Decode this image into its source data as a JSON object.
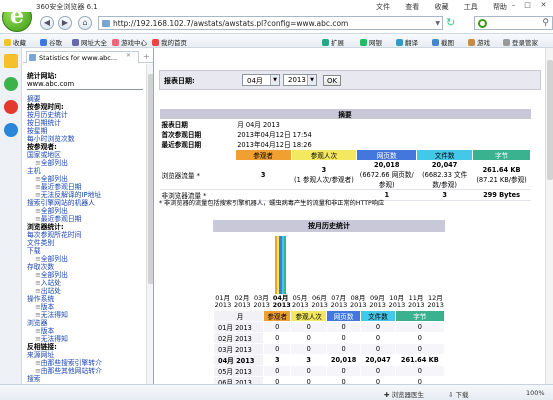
{
  "browser": {
    "title": "360安全浏览器 6.1",
    "menus": [
      "文件",
      "查看",
      "收藏",
      "工具",
      "帮助"
    ],
    "url": "http://192.168.102.7/awstats/awstats.pl?config=www.abc.com",
    "favorites": [
      "收藏",
      "谷歌",
      "网址大全",
      "游戏中心",
      "我的首页"
    ],
    "toolbar_right": [
      "扩展",
      "网银",
      "翻译",
      "截图",
      "游戏",
      "登录管家"
    ],
    "status": [
      "浏览器医生",
      "下载",
      "100%"
    ]
  },
  "sidebar": {
    "tab_title": "Statistics for www.abc...",
    "stats_label": "统计网站:",
    "site": "www.abc.com",
    "items": [
      {
        "t": "lk",
        "v": "摘要"
      },
      {
        "t": "sec",
        "v": "按参观时间:"
      },
      {
        "t": "lk",
        "v": "按月历史统计"
      },
      {
        "t": "lk",
        "v": "按日期统计"
      },
      {
        "t": "lk",
        "v": "按星期"
      },
      {
        "t": "lk",
        "v": "每小时浏览次数"
      },
      {
        "t": "sec",
        "v": "按参观者:"
      },
      {
        "t": "lk",
        "v": "国家或地区"
      },
      {
        "t": "sub",
        "v": "全部列出"
      },
      {
        "t": "lk",
        "v": "主机"
      },
      {
        "t": "sub",
        "v": "全部列出"
      },
      {
        "t": "sub",
        "v": "最近参观日期"
      },
      {
        "t": "sub",
        "v": "无法反解译的IP地址"
      },
      {
        "t": "lk",
        "v": "搜索引擎网站的机器人"
      },
      {
        "t": "sub",
        "v": "全部列出"
      },
      {
        "t": "sub",
        "v": "最近参观日期"
      },
      {
        "t": "sec",
        "v": "浏览器统计:"
      },
      {
        "t": "lk",
        "v": "每次参观所花时间"
      },
      {
        "t": "lk",
        "v": "文件类别"
      },
      {
        "t": "lk",
        "v": "下载"
      },
      {
        "t": "sub",
        "v": "全部列出"
      },
      {
        "t": "lk",
        "v": "存取次数"
      },
      {
        "t": "sub",
        "v": "全部列出"
      },
      {
        "t": "sub",
        "v": "入站处"
      },
      {
        "t": "sub",
        "v": "出站处"
      },
      {
        "t": "lk",
        "v": "操作系统"
      },
      {
        "t": "sub",
        "v": "版本"
      },
      {
        "t": "sub",
        "v": "无法得知"
      },
      {
        "t": "lk",
        "v": "浏览器"
      },
      {
        "t": "sub",
        "v": "版本"
      },
      {
        "t": "sub",
        "v": "无法得知"
      },
      {
        "t": "sec",
        "v": "反相链接:"
      },
      {
        "t": "lk",
        "v": "来源网址"
      },
      {
        "t": "sub",
        "v": "由那些搜索引擎转介"
      },
      {
        "t": "sub",
        "v": "由那些其他网站转介"
      },
      {
        "t": "lk",
        "v": "搜索"
      }
    ]
  },
  "main": {
    "date_label": "报表日期:",
    "month": "04月",
    "year": "2013",
    "ok": "OK",
    "summary": {
      "caption": "摘要",
      "report_date_k": "报表日期",
      "report_date_v": "月 04月 2013",
      "first_k": "首次参观日期",
      "first_v": "2013年04月12日 17:54",
      "last_k": "最近参观日期",
      "last_v": "2013年04月12日 18:26",
      "headers": [
        "参观者",
        "参观人次",
        "网页数",
        "文件数",
        "字节"
      ],
      "rows": [
        {
          "label": "浏览器流量 *",
          "visitors": "3",
          "visits": "3",
          "visits_note": "(1 参观人次/参观者)",
          "pages": "20,018",
          "pages_note": "(6672.66 网页数/参观)",
          "files": "20,047",
          "files_note": "(6682.33 文件数/参观)",
          "bytes": "261.64 KB",
          "bytes_note": "(87.21 KB/参观)"
        },
        {
          "label": "非浏览器流量 *",
          "visitors": "",
          "visits": "",
          "visits_note": "",
          "pages": "1",
          "pages_note": "",
          "files": "3",
          "files_note": "",
          "bytes": "299 Bytes",
          "bytes_note": ""
        }
      ],
      "footnote": "* 非浏览器的流量包括搜索引擎机器人，蠕虫病毒产生的流量和非正常的HTTP响应"
    },
    "history": {
      "caption": "按月历史统计",
      "months": [
        {
          "m": "01月",
          "y": "2013"
        },
        {
          "m": "02月",
          "y": "2013"
        },
        {
          "m": "03月",
          "y": "2013"
        },
        {
          "m": "04月",
          "y": "2013"
        },
        {
          "m": "05月",
          "y": "2013"
        },
        {
          "m": "06月",
          "y": "2013"
        },
        {
          "m": "07月",
          "y": "2013"
        },
        {
          "m": "08月",
          "y": "2013"
        },
        {
          "m": "09月",
          "y": "2013"
        },
        {
          "m": "10月",
          "y": "2013"
        },
        {
          "m": "11月",
          "y": "2013"
        },
        {
          "m": "12月",
          "y": "2013"
        }
      ],
      "table_headers": [
        "月",
        "参观者",
        "参观人次",
        "网页数",
        "文件数",
        "字节"
      ],
      "rows": [
        [
          "01月 2013",
          "0",
          "0",
          "0",
          "0",
          "0"
        ],
        [
          "02月 2013",
          "0",
          "0",
          "0",
          "0",
          "0"
        ],
        [
          "03月 2013",
          "0",
          "0",
          "0",
          "0",
          "0"
        ],
        [
          "04月 2013",
          "3",
          "3",
          "20,018",
          "20,047",
          "261.64 KB"
        ],
        [
          "05月 2013",
          "0",
          "0",
          "0",
          "0",
          "0"
        ],
        [
          "06月 2013",
          "0",
          "0",
          "0",
          "0",
          "0"
        ]
      ]
    }
  },
  "chart_data": {
    "type": "bar",
    "categories": [
      "01月 2013",
      "02月 2013",
      "03月 2013",
      "04月 2013",
      "05月 2013",
      "06月 2013",
      "07月 2013",
      "08月 2013",
      "09月 2013",
      "10月 2013",
      "11月 2013",
      "12月 2013"
    ],
    "series": [
      {
        "name": "参观者",
        "values": [
          0,
          0,
          0,
          3,
          0,
          0,
          0,
          0,
          0,
          0,
          0,
          0
        ]
      },
      {
        "name": "参观人次",
        "values": [
          0,
          0,
          0,
          3,
          0,
          0,
          0,
          0,
          0,
          0,
          0,
          0
        ]
      },
      {
        "name": "网页数",
        "values": [
          0,
          0,
          0,
          20018,
          0,
          0,
          0,
          0,
          0,
          0,
          0,
          0
        ]
      },
      {
        "name": "文件数",
        "values": [
          0,
          0,
          0,
          20047,
          0,
          0,
          0,
          0,
          0,
          0,
          0,
          0
        ]
      },
      {
        "name": "字节",
        "values": [
          0,
          0,
          0,
          261.64,
          0,
          0,
          0,
          0,
          0,
          0,
          0,
          0
        ]
      }
    ],
    "colors": [
      "#f0a030",
      "#f4e860",
      "#4477dd",
      "#44c8e8",
      "#3ab290"
    ]
  }
}
